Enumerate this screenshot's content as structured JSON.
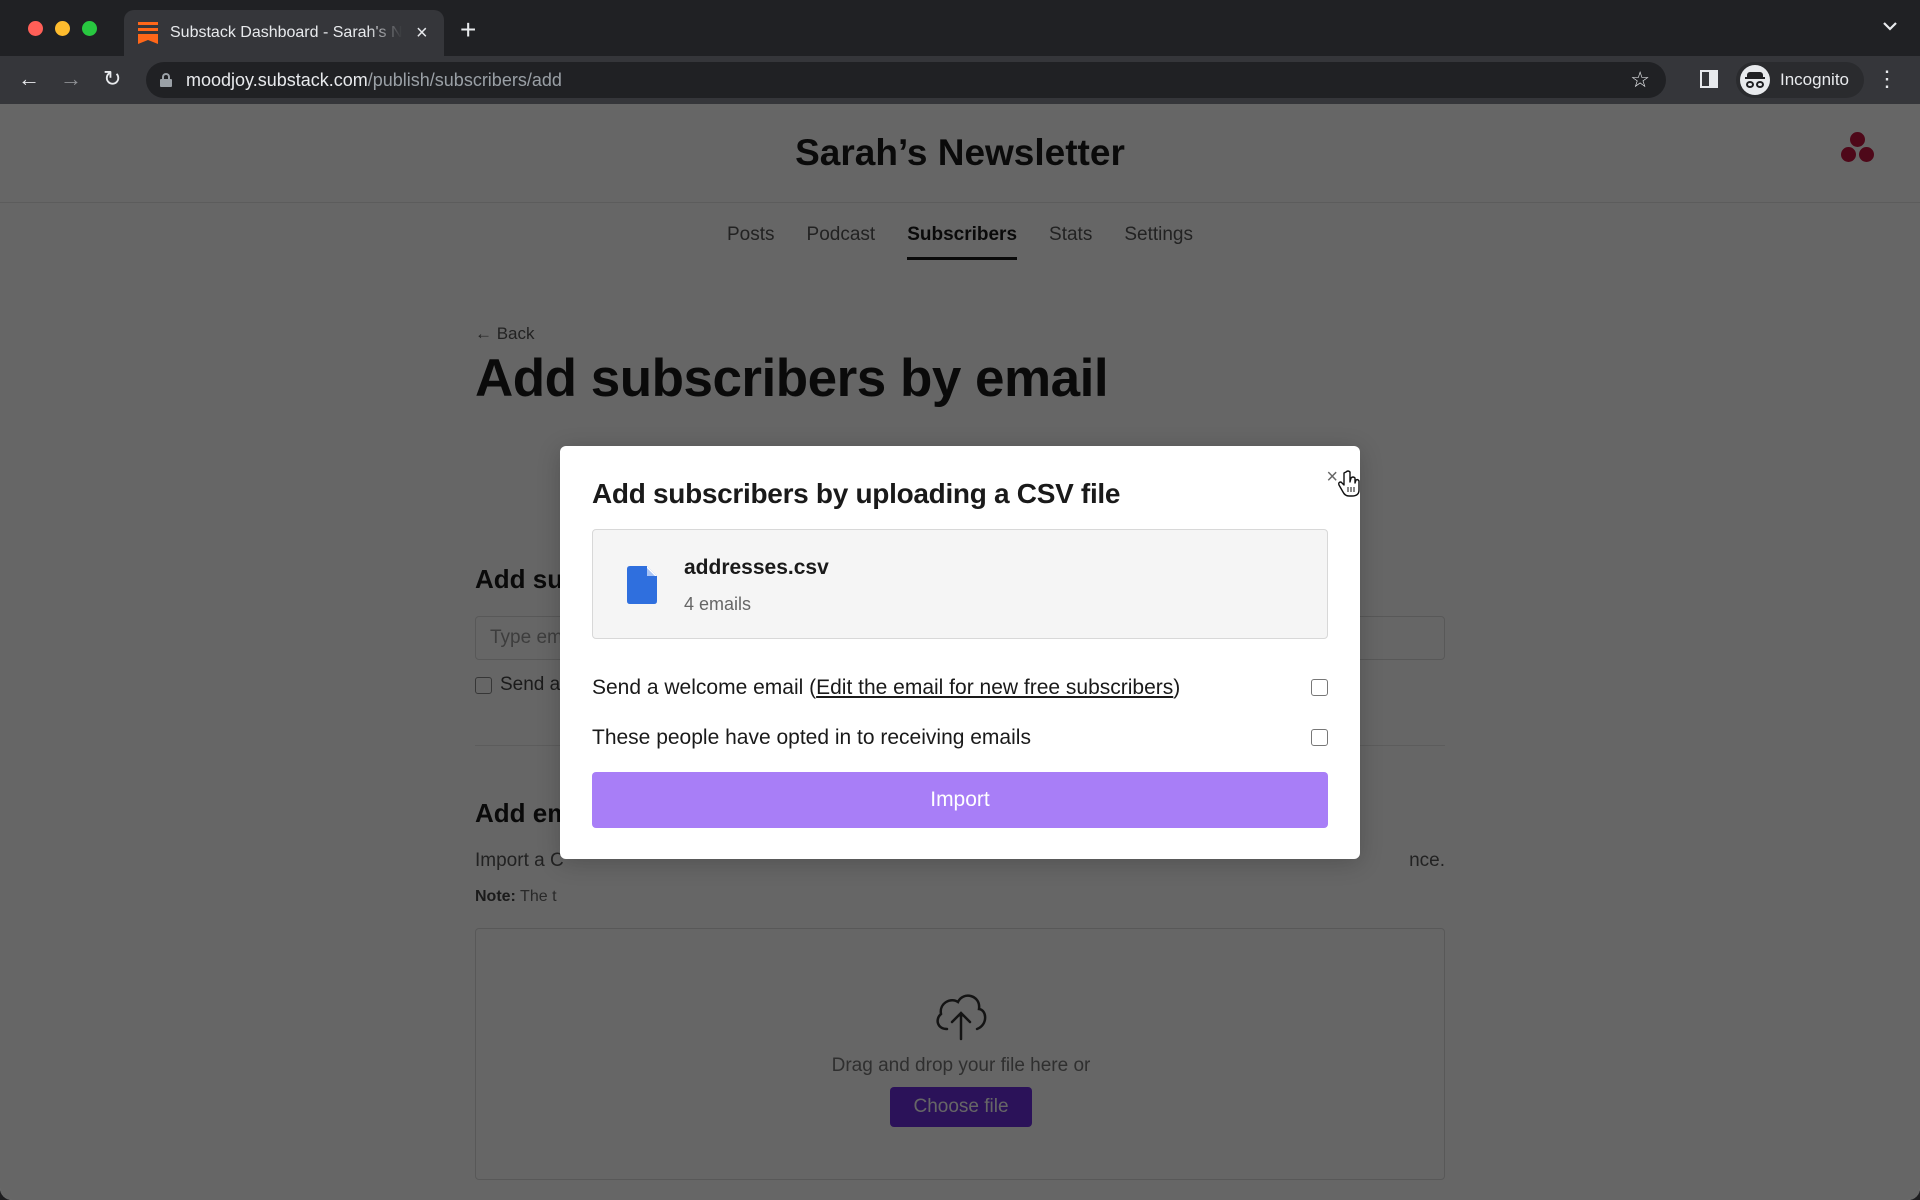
{
  "browser": {
    "tab_title": "Substack Dashboard - Sarah's Newsletter",
    "tab_close": "×",
    "new_tab": "+",
    "tab_list_icon": "⌄",
    "back_icon": "←",
    "forward_icon": "→",
    "reload_icon": "↻",
    "url_host": "moodjoy.substack.com",
    "url_path": "/publish/subscribers/add",
    "star_icon": "☆",
    "profile_label": "Incognito",
    "menu_icon": "⋮"
  },
  "header": {
    "publication_title": "Sarah’s Newsletter",
    "nav": [
      {
        "label": "Posts",
        "active": false
      },
      {
        "label": "Podcast",
        "active": false
      },
      {
        "label": "Subscribers",
        "active": true
      },
      {
        "label": "Stats",
        "active": false
      },
      {
        "label": "Settings",
        "active": false
      }
    ]
  },
  "main": {
    "back_label": "← Back",
    "heading": "Add subscribers by email",
    "section1": {
      "title": "Add su",
      "input_placeholder": "Type em",
      "checkbox_label": "Send a"
    },
    "section2": {
      "title": "Add em",
      "description_start": "Import a C",
      "description_end": "nce.",
      "note_label": "Note:",
      "note_text": " The t",
      "drop_text": "Drag and drop your file here or",
      "choose_file": "Choose file"
    }
  },
  "modal": {
    "title": "Add subscribers by uploading a CSV file",
    "close_icon": "×",
    "file": {
      "name": "addresses.csv",
      "count": "4 emails",
      "icon_color": "#2f6fde"
    },
    "options": [
      {
        "prefix": "Send a welcome email (",
        "link": "Edit the email for new free subscribers",
        "suffix": ")",
        "checked": false
      },
      {
        "prefix": "These people have opted in to receiving emails",
        "link": "",
        "suffix": "",
        "checked": false
      }
    ],
    "import_label": "Import",
    "import_color": "#a87ef7"
  }
}
